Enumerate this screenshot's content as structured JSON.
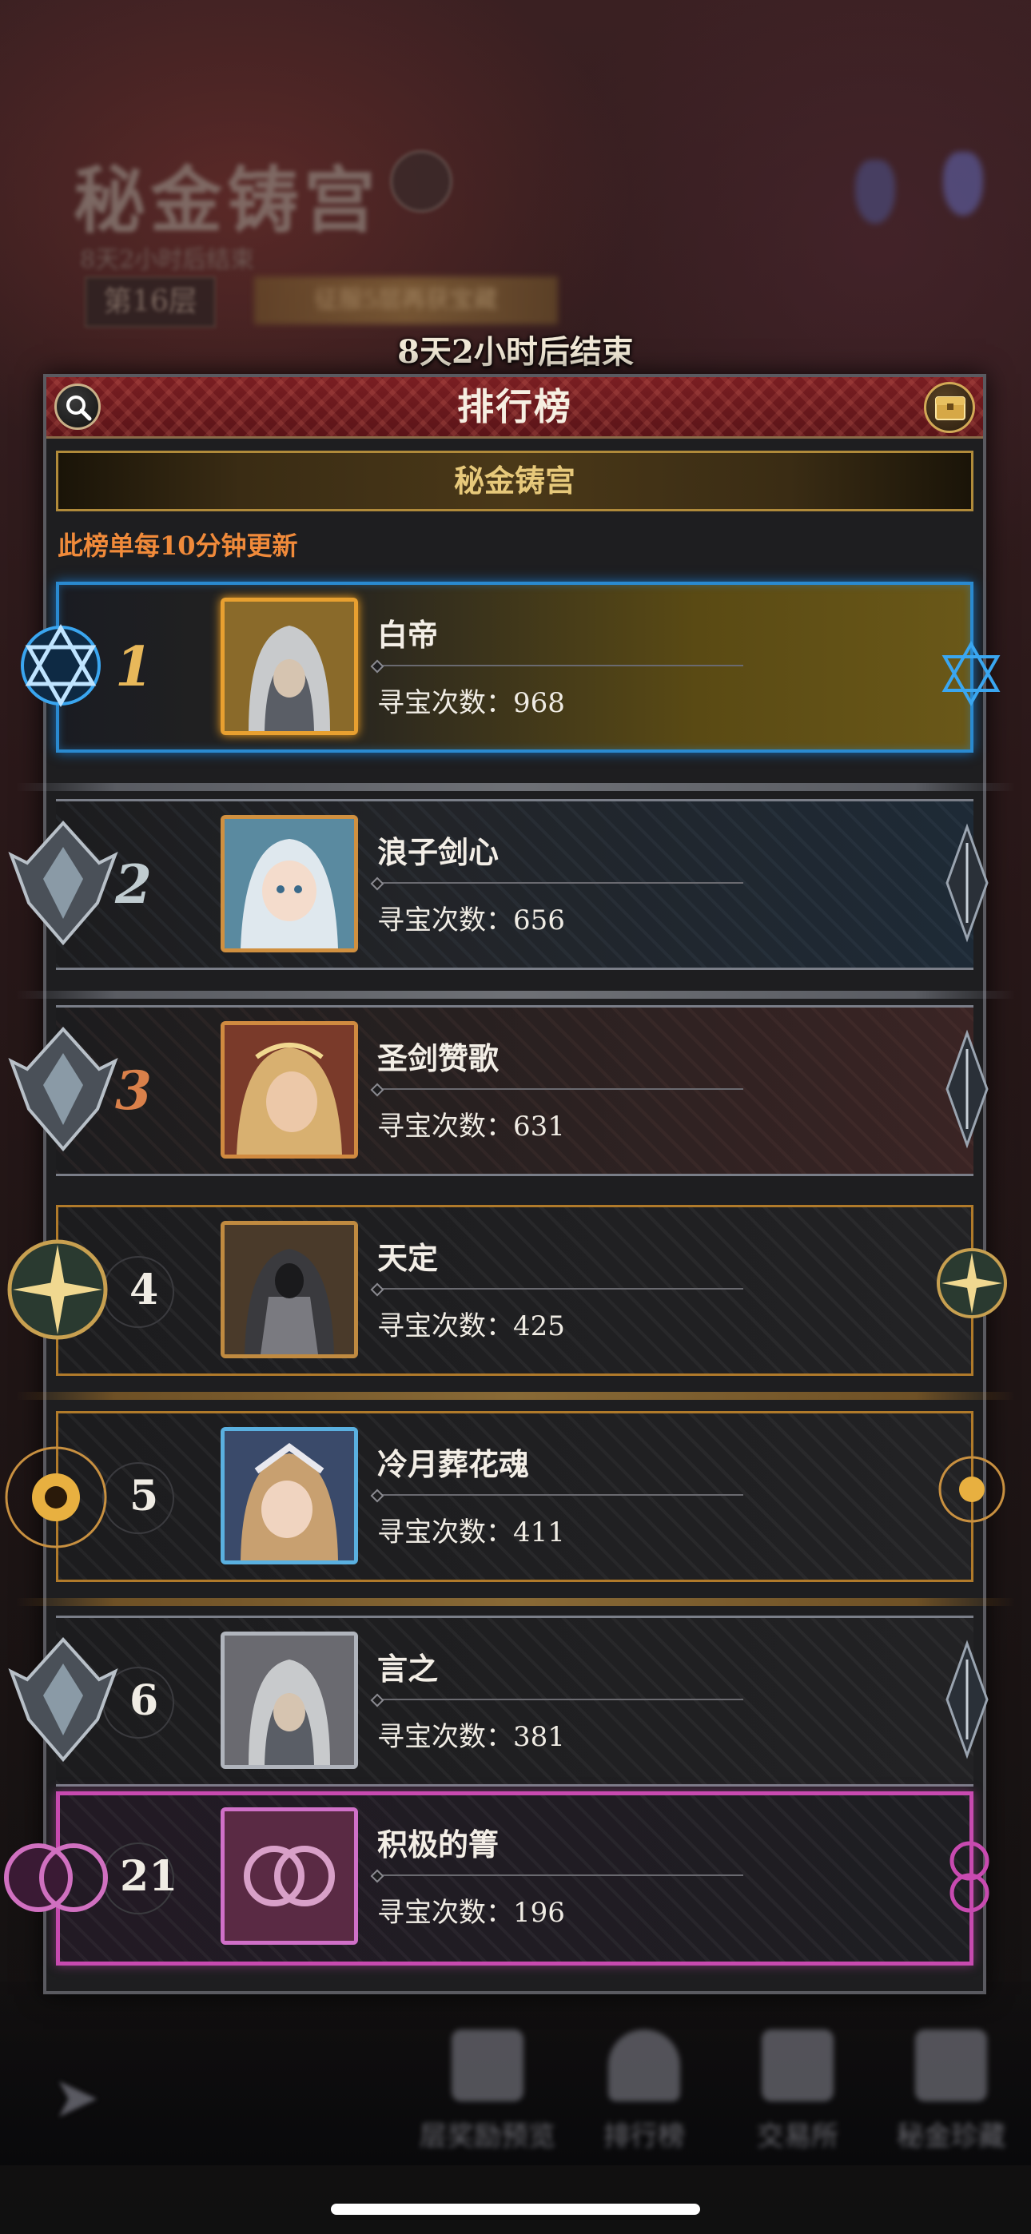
{
  "background": {
    "title": "秘金铸宫",
    "subtitle": "8天2小时后结束",
    "floor": "第16层",
    "banner": "征服5层再获宝藏"
  },
  "timer": "8天2小时后结束",
  "modal": {
    "title": "排行榜",
    "section": "秘金铸宫",
    "notice": "此榜单每10分钟更新"
  },
  "ranking": [
    {
      "rank": "1",
      "name": "白帝",
      "score_label": "寻宝次数：968",
      "tier": "gold"
    },
    {
      "rank": "2",
      "name": "浪子剑心",
      "score_label": "寻宝次数：656",
      "tier": "silver"
    },
    {
      "rank": "3",
      "name": "圣剑赞歌",
      "score_label": "寻宝次数：631",
      "tier": "bronze"
    },
    {
      "rank": "4",
      "name": "天定",
      "score_label": "寻宝次数：425",
      "tier": "compass"
    },
    {
      "rank": "5",
      "name": "冷月葬花魂",
      "score_label": "寻宝次数：411",
      "tier": "sun"
    },
    {
      "rank": "6",
      "name": "言之",
      "score_label": "寻宝次数：381",
      "tier": "wing"
    },
    {
      "rank": "21",
      "name": "积极的箐",
      "score_label": "寻宝次数：196",
      "tier": "self"
    }
  ],
  "nav": {
    "items": [
      {
        "label": "层奖励预览",
        "icon": "reward-preview-icon"
      },
      {
        "label": "排行榜",
        "icon": "trophy-icon"
      },
      {
        "label": "交易所",
        "icon": "exchange-icon"
      },
      {
        "label": "秘金珍藏",
        "icon": "collection-icon"
      }
    ]
  },
  "colors": {
    "header_red": "#7a1e22",
    "gold": "#e6c87a",
    "notice_orange": "#f08a3a",
    "rank1_gold": "#e8b85a",
    "rank2_silver": "#b8c4c8",
    "rank3_bronze": "#d9804a",
    "self_pink": "#c84ab0"
  }
}
